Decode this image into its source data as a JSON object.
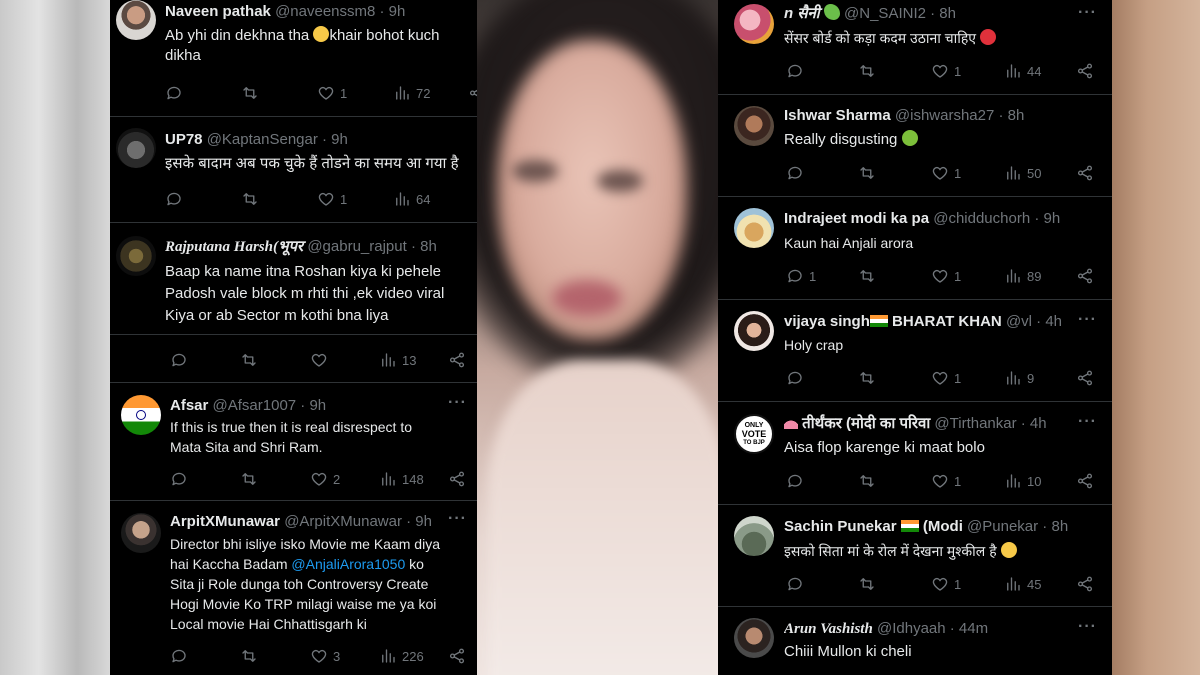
{
  "left_column": {
    "tweets": [
      {
        "name": "Naveen pathak",
        "handle": "@naveenssm8 · 9h",
        "text_a": "Ab yhi din dekhna tha ",
        "text_b": "khair bohot kuch dikha",
        "replies": "",
        "retweets": "",
        "likes": "1",
        "views": "72"
      },
      {
        "name": "UP78",
        "handle": "@KaptanSengar · 9h",
        "text": "इसके बादाम अब पक चुके हैं तोडने का समय आ गया है",
        "replies": "",
        "retweets": "",
        "likes": "1",
        "views": "64"
      },
      {
        "name": "Rajputana Harsh(भूपर",
        "handle": "@gabru_rajput · 8h",
        "text": "Baap ka name itna Roshan kiya ki pehele\nPadosh vale block m rhti thi ,ek video viral\nKiya or ab Sector m kothi bna liya",
        "replies": "",
        "retweets": "",
        "likes": "",
        "views": "13"
      },
      {
        "name": "Afsar",
        "handle": "@Afsar1007 · 9h",
        "text": "If this is true then it is real disrespect to\nMata Sita and Shri Ram.",
        "replies": "",
        "retweets": "",
        "likes": "2",
        "views": "148"
      },
      {
        "name": "ArpitXMunawar",
        "handle": "@ArpitXMunawar · 9h",
        "text_a": "Director bhi isliye isko Movie me Kaam diya\nhai Kaccha Badam ",
        "mention": "@AnjaliArora1050",
        "text_b": " ko\nSita ji Role dunga toh Controversy Create\nHogi Movie Ko TRP milagi waise me ya koi\nLocal movie Hai Chhattisgarh ki",
        "replies": "",
        "retweets": "",
        "likes": "3",
        "views": "226"
      }
    ]
  },
  "right_column": {
    "tweets": [
      {
        "name": "n सैनी",
        "handle": "@N_SAINI2 · 8h",
        "text": "सेंसर बोर्ड को कड़ा कदम उठाना चाहिए ",
        "replies": "",
        "retweets": "",
        "likes": "1",
        "views": "44"
      },
      {
        "name": "Ishwar Sharma",
        "handle": "@ishwarsha27 · 8h",
        "text": "Really disgusting ",
        "replies": "",
        "retweets": "",
        "likes": "1",
        "views": "50"
      },
      {
        "name": "Indrajeet modi ka pa",
        "handle": "@chidduchorh · 9h",
        "text": "Kaun hai Anjali arora",
        "replies": "1",
        "retweets": "",
        "likes": "1",
        "views": "89"
      },
      {
        "name": "vijaya singh",
        "name_b": " BHARAT KHAN",
        "handle": "@vl · 4h",
        "text": "Holy crap",
        "replies": "",
        "retweets": "",
        "likes": "1",
        "views": "9"
      },
      {
        "name": "तीर्थंकर (मोदी का परिवा",
        "handle": "@Tirthankar · 4h",
        "text": "Aisa flop karenge ki maat bolo",
        "replies": "",
        "retweets": "",
        "likes": "1",
        "views": "10",
        "avatar_text": [
          "ONLY",
          "VOTE",
          "TO BJP"
        ]
      },
      {
        "name": "Sachin Punekar",
        "name_b": " (Modi",
        "handle": "@Punekar · 8h",
        "text": "इसको सिता मां के रोल में देखना मुश्कील है ",
        "replies": "",
        "retweets": "",
        "likes": "1",
        "views": "45"
      },
      {
        "name": "Arun Vashisth",
        "handle": "@Idhyaah · 44m",
        "text": "Chiii Mullon ki cheli"
      }
    ]
  },
  "colors": {
    "background": "#000000",
    "text": "#e7e9ea",
    "muted": "#71767b",
    "link": "#1d9bf0",
    "divider": "#2f3336"
  },
  "icons": [
    "reply-icon",
    "retweet-icon",
    "like-icon",
    "views-icon",
    "share-icon",
    "more-icon"
  ]
}
